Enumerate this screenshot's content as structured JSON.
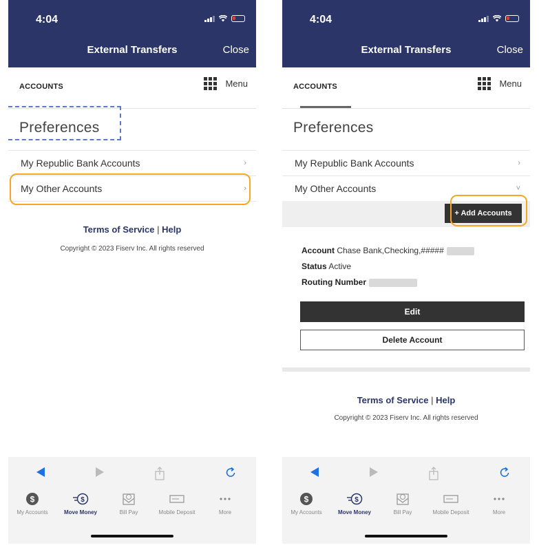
{
  "status": {
    "time": "4:04"
  },
  "nav": {
    "title": "External Transfers",
    "close": "Close"
  },
  "tabs": {
    "accounts": "ACCOUNTS",
    "menu": "Menu"
  },
  "preferences": {
    "title": "Preferences"
  },
  "list": {
    "republic": "My Republic Bank Accounts",
    "other": "My Other Accounts"
  },
  "footer": {
    "terms": "Terms of Service",
    "sep": "|",
    "help": "Help",
    "copyright": "Copyright © 2023 Fiserv Inc. All rights reserved"
  },
  "add_accounts": "+ Add Accounts",
  "account_detail": {
    "account_label": "Account",
    "account_value": "Chase Bank,Checking,#####",
    "status_label": "Status",
    "status_value": "Active",
    "routing_label": "Routing Number"
  },
  "buttons": {
    "edit": "Edit",
    "delete": "Delete Account"
  },
  "bottom_nav": [
    {
      "label": "My Accounts",
      "icon": "dollar-circle-icon"
    },
    {
      "label": "Move Money",
      "icon": "move-money-icon"
    },
    {
      "label": "Bill Pay",
      "icon": "bill-pay-icon"
    },
    {
      "label": "Mobile Deposit",
      "icon": "mobile-deposit-icon"
    },
    {
      "label": "More",
      "icon": "more-dots-icon"
    }
  ],
  "colors": {
    "brand": "#2c3567",
    "highlight": "#f5a623",
    "focus_dashed": "#5c78c8",
    "browser_blue": "#1f6fe5"
  }
}
